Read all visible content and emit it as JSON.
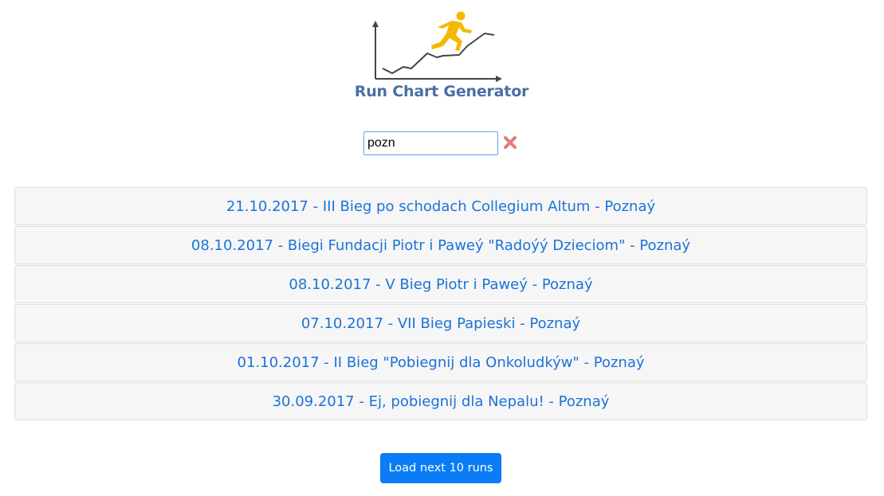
{
  "app": {
    "logo_title": "Run Chart Generator"
  },
  "search": {
    "value": "pozn",
    "clear_icon": "close-x-icon"
  },
  "runs": [
    "21.10.2017 - III Bieg po schodach Collegium Altum - Poznaý",
    "08.10.2017 - Biegi Fundacji Piotr i Paweý \"Radoýý Dzieciom\" - Poznaý",
    "08.10.2017 - V Bieg Piotr i Paweý - Poznaý",
    "07.10.2017 - VII Bieg Papieski - Poznaý",
    "01.10.2017 - II Bieg \"Pobiegnij dla Onkoludkýw\" - Poznaý",
    "30.09.2017 - Ej, pobiegnij dla Nepalu! - Poznaý"
  ],
  "load_more": {
    "label": "Load next 10 runs"
  },
  "colors": {
    "logo_text": "#4a6fa5",
    "runner": "#f5b800",
    "link": "#1a73d9",
    "button": "#0a7cf5",
    "clear_icon": "#e07b7b"
  }
}
